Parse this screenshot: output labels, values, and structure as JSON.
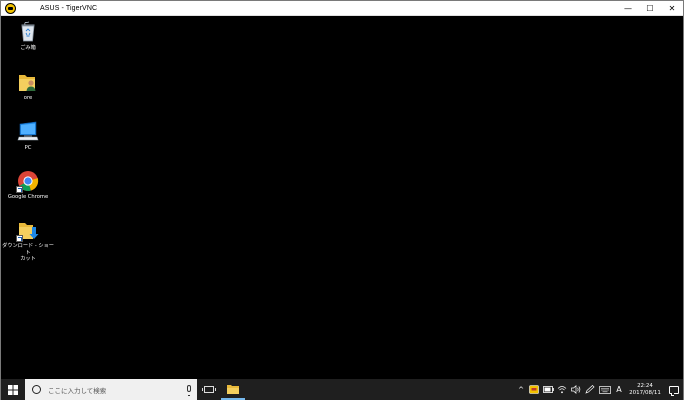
{
  "window": {
    "title": "ASUS - TigerVNC",
    "minimize_glyph": "—",
    "maximize_glyph": "☐",
    "close_glyph": "✕"
  },
  "desktop": {
    "icons": [
      {
        "label": "ごみ箱",
        "icon": "recycle-bin-icon",
        "shortcut": false
      },
      {
        "label": "ore",
        "icon": "user-folder-icon",
        "shortcut": false
      },
      {
        "label": "PC",
        "icon": "computer-icon",
        "shortcut": false
      },
      {
        "label": "Google Chrome",
        "icon": "chrome-icon",
        "shortcut": true
      },
      {
        "label": "ダウンロード - ショート\nカット",
        "icon": "downloads-folder-icon",
        "shortcut": true
      }
    ]
  },
  "taskbar": {
    "search_placeholder": "ここに入力して検索",
    "ime_mode": "A",
    "clock_time": "22:24",
    "clock_date": "2017/08/11",
    "chevron_glyph": "^"
  },
  "colors": {
    "taskbar": "#1f1f1f",
    "desktop": "#000000",
    "accent": "#76b9ed",
    "folder": "#e8b93a"
  }
}
